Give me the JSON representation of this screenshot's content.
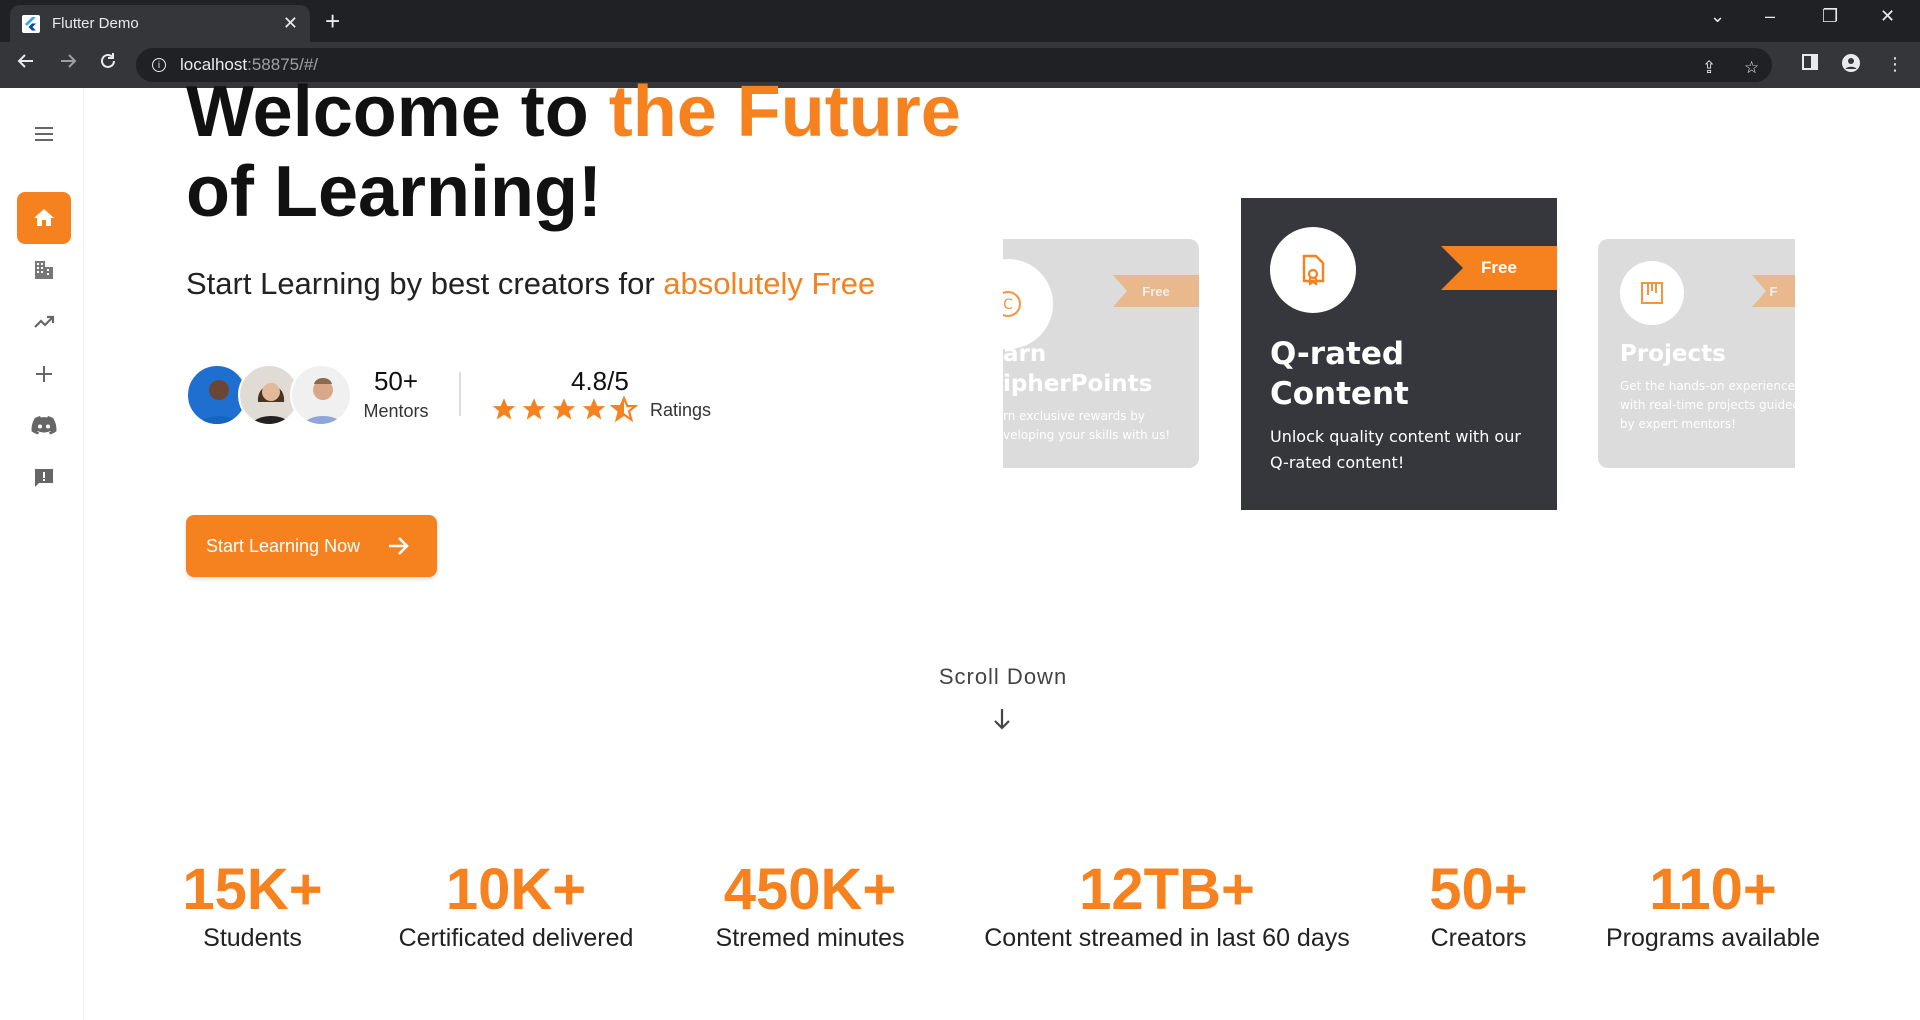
{
  "browser": {
    "tab_title": "Flutter Demo",
    "url_host": "localhost",
    "url_rest": ":58875/#/"
  },
  "sidebar": {
    "items": [
      {
        "icon": "menu-icon"
      },
      {
        "icon": "home-icon",
        "active": true
      },
      {
        "icon": "buildings-icon"
      },
      {
        "icon": "trending-up-icon"
      },
      {
        "icon": "plus-icon"
      },
      {
        "icon": "discord-icon"
      },
      {
        "icon": "feedback-icon"
      }
    ]
  },
  "hero": {
    "title_part1": "Welcome to ",
    "title_highlight": "the Future",
    "title_part2": "of Learning!",
    "subtitle_part1": "Start Learning by best creators for ",
    "subtitle_highlight": "absolutely Free",
    "mentors_count": "50+",
    "mentors_label": "Mentors",
    "rating_value": "4.8/5",
    "rating_stars": 4.5,
    "ratings_label": "Ratings",
    "cta_label": "Start Learning Now"
  },
  "cards": {
    "left": {
      "ribbon": "Free",
      "title_line1": "arn",
      "title_line2": "ipherPoints",
      "desc_line1": "rn exclusive rewards by",
      "desc_line2": "veloping your skills with us!"
    },
    "center": {
      "ribbon": "Free",
      "title_line1": "Q-rated",
      "title_line2": "Content",
      "desc_line1": "Unlock quality content with our",
      "desc_line2": "Q-rated content!"
    },
    "right": {
      "ribbon": "F",
      "title": "Projects",
      "desc_line1": "Get the hands-on experience",
      "desc_line2": "with real-time projects guided",
      "desc_line3": "by expert mentors!"
    }
  },
  "scroll_label": "Scroll Down",
  "stats": [
    {
      "number": "15K+",
      "label": "Students"
    },
    {
      "number": "10K+",
      "label": "Certificated delivered"
    },
    {
      "number": "450K+",
      "label": "Stremed minutes"
    },
    {
      "number": "12TB+",
      "label": "Content streamed in last 60 days"
    },
    {
      "number": "50+",
      "label": "Creators"
    },
    {
      "number": "110+",
      "label": "Programs available"
    }
  ],
  "colors": {
    "accent": "#f5821f",
    "card_dark": "#35373d",
    "chrome": "#202124"
  }
}
